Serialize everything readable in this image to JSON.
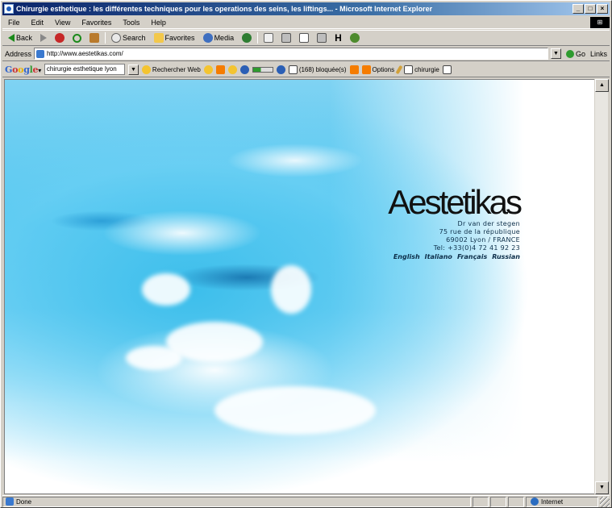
{
  "window": {
    "title": "Chirurgie esthetique : les différentes techniques pour les operations des seins, les liftings... - Microsoft Internet Explorer",
    "buttons": {
      "minimize": "_",
      "maximize": "□",
      "close": "×"
    }
  },
  "menu": {
    "items": [
      "File",
      "Edit",
      "View",
      "Favorites",
      "Tools",
      "Help"
    ]
  },
  "toolbar": {
    "back": "Back",
    "search": "Search",
    "favorites": "Favorites",
    "media": "Media",
    "h_label": "H"
  },
  "address": {
    "label": "Address",
    "url": "http://www.aestetikas.com/",
    "go": "Go",
    "links": "Links"
  },
  "google": {
    "search_value": "chirurgie esthetique lyon",
    "search_web": "Rechercher Web",
    "popups_blocked": "(168) bloquée(s)",
    "options": "Options",
    "highlight": "chirurgie"
  },
  "page": {
    "brand": "Aestetikas",
    "address_lines": [
      "Dr van der stegen",
      "75 rue de la république",
      "69002 Lyon / FRANCE",
      "Tel: +33(0)4 72 41 92 23"
    ],
    "languages": [
      "English",
      "Italiano",
      "Français",
      "Russian"
    ]
  },
  "status": {
    "text": "Done",
    "zone": "Internet"
  }
}
